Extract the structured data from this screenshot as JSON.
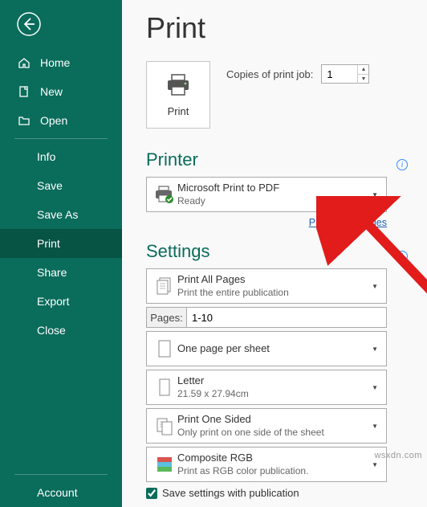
{
  "sidebar": {
    "home": "Home",
    "new": "New",
    "open": "Open",
    "info": "Info",
    "save": "Save",
    "saveas": "Save As",
    "print": "Print",
    "share": "Share",
    "export": "Export",
    "close": "Close",
    "account": "Account"
  },
  "header": {
    "title": "Print",
    "print_button_label": "Print"
  },
  "copies": {
    "label": "Copies of print job:",
    "value": "1"
  },
  "printer_section": {
    "heading": "Printer",
    "selected_title": "Microsoft Print to PDF",
    "selected_status": "Ready",
    "properties_link": "Printer Properties"
  },
  "settings": {
    "heading": "Settings",
    "print_all": {
      "title": "Print All Pages",
      "sub": "Print the entire publication"
    },
    "pages_label": "Pages:",
    "pages_value": "1-10",
    "per_sheet": {
      "title": "One page per sheet"
    },
    "paper": {
      "title": "Letter",
      "sub": "21.59 x 27.94cm"
    },
    "sided": {
      "title": "Print One Sided",
      "sub": "Only print on one side of the sheet"
    },
    "color": {
      "title": "Composite RGB",
      "sub": "Print as RGB color publication."
    },
    "save_settings": "Save settings with publication"
  },
  "watermark": "wsxdn.com"
}
